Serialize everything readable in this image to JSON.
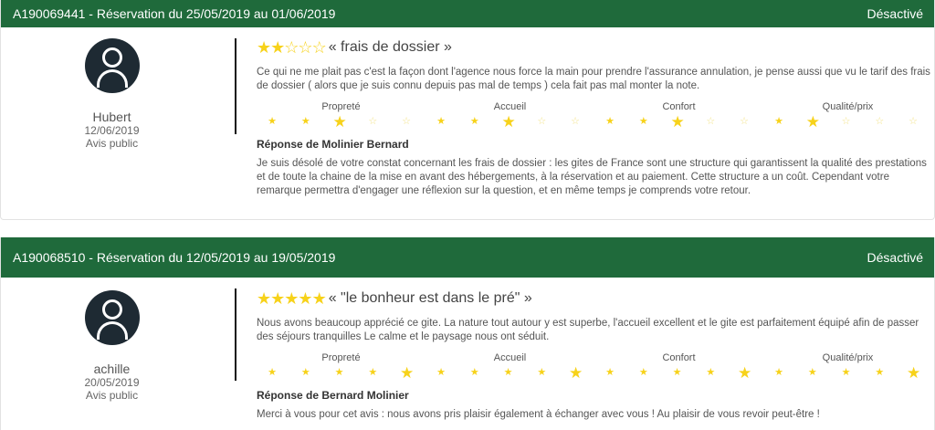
{
  "reviews": [
    {
      "header": "A190069441 - Réservation du 25/05/2019 au 01/06/2019",
      "status": "Désactivé",
      "author": {
        "name": "Hubert",
        "date": "12/06/2019",
        "visibility": "Avis public"
      },
      "rating": 2,
      "title": "« frais de dossier »",
      "body": "Ce qui ne me plait pas c'est la façon dont l'agence nous force la main pour prendre l'assurance annulation, je pense aussi que vu le tarif des frais de dossier ( alors que je suis connu depuis pas mal de temps ) cela fait pas mal monter la note.",
      "criteria": [
        {
          "label": "Propreté",
          "rating": 3
        },
        {
          "label": "Accueil",
          "rating": 3
        },
        {
          "label": "Confort",
          "rating": 3
        },
        {
          "label": "Qualité/prix",
          "rating": 2
        }
      ],
      "response_title": "Réponse de Molinier Bernard",
      "response_text": "Je suis désolé de votre constat concernant les frais de dossier : les gites de France sont une structure qui garantissent la qualité des prestations et de toute la chaine de la mise en avant des hébergements, à la réservation et au paiement. Cette structure a un coût. Cependant votre remarque permettra d'engager une réflexion sur la question, et en même temps je comprends votre retour."
    },
    {
      "header": "A190068510 - Réservation du 12/05/2019 au 19/05/2019",
      "status": "Désactivé",
      "author": {
        "name": "achille",
        "date": "20/05/2019",
        "visibility": "Avis public"
      },
      "rating": 5,
      "title": "« \"le bonheur est dans le pré\" »",
      "body": "Nous avons beaucoup apprécié ce gite. La nature tout autour y est superbe, l'accueil excellent et le gite est parfaitement équipé afin de passer des séjours tranquilles Le calme et le paysage nous ont séduit.",
      "criteria": [
        {
          "label": "Propreté",
          "rating": 5
        },
        {
          "label": "Accueil",
          "rating": 5
        },
        {
          "label": "Confort",
          "rating": 5
        },
        {
          "label": "Qualité/prix",
          "rating": 5
        }
      ],
      "response_title": "Réponse de Bernard Molinier",
      "response_text": "Merci à vous pour cet avis : nous avons pris plaisir également à échanger avec vous ! Au plaisir de vous revoir peut-être !"
    }
  ],
  "colors": {
    "header_bg": "#1f6a3b",
    "star": "#f7d21a",
    "avatar": "#1e2a33"
  },
  "icons": {
    "avatar": "user-avatar-icon",
    "star": "star-icon"
  }
}
